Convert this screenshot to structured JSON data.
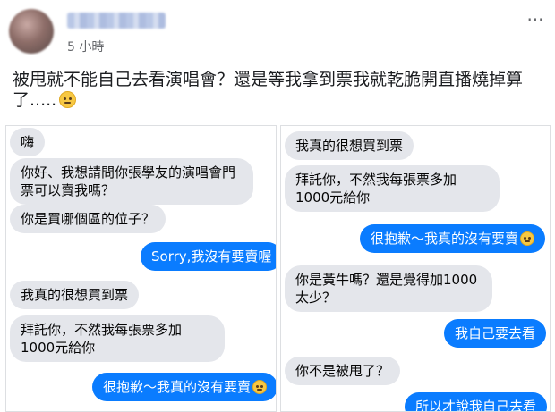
{
  "post": {
    "timestamp": "5 小時",
    "more_label": "···",
    "text": "被甩就不能自己去看演唱會？還是等我拿到票我就乾脆開直播燒掉算了.....",
    "emoji": "worried-face-emoji"
  },
  "left_chat": {
    "messages": [
      {
        "side": "in",
        "text": "嗨"
      },
      {
        "side": "in",
        "text": "你好、我想請問你張學友的演唱會門票可以賣我嗎？"
      },
      {
        "side": "in",
        "text": "你是買哪個區的位子？"
      },
      {
        "side": "out",
        "text": "Sorry,我沒有要賣喔"
      },
      {
        "side": "in",
        "text": "我真的很想買到票"
      },
      {
        "side": "in",
        "text": "拜託你，不然我每張票多加1000元給你"
      },
      {
        "side": "out",
        "text": "很抱歉～我真的沒有要賣"
      }
    ]
  },
  "right_chat": {
    "messages": [
      {
        "side": "in",
        "text": "我真的很想買到票"
      },
      {
        "side": "in",
        "text": "拜託你，不然我每張票多加1000元給你"
      },
      {
        "side": "out",
        "text": "很抱歉～我真的沒有要賣"
      },
      {
        "side": "in",
        "text": "你是黃牛嗎？還是覺得加1000太少？"
      },
      {
        "side": "out",
        "text": "我自己要去看"
      },
      {
        "side": "in",
        "text": "你不是被甩了？"
      },
      {
        "side": "out",
        "text": "所以才說我自己去看"
      }
    ]
  },
  "colors": {
    "outgoing_bubble": "#0a7cff",
    "incoming_bubble": "#e4e6eb"
  }
}
